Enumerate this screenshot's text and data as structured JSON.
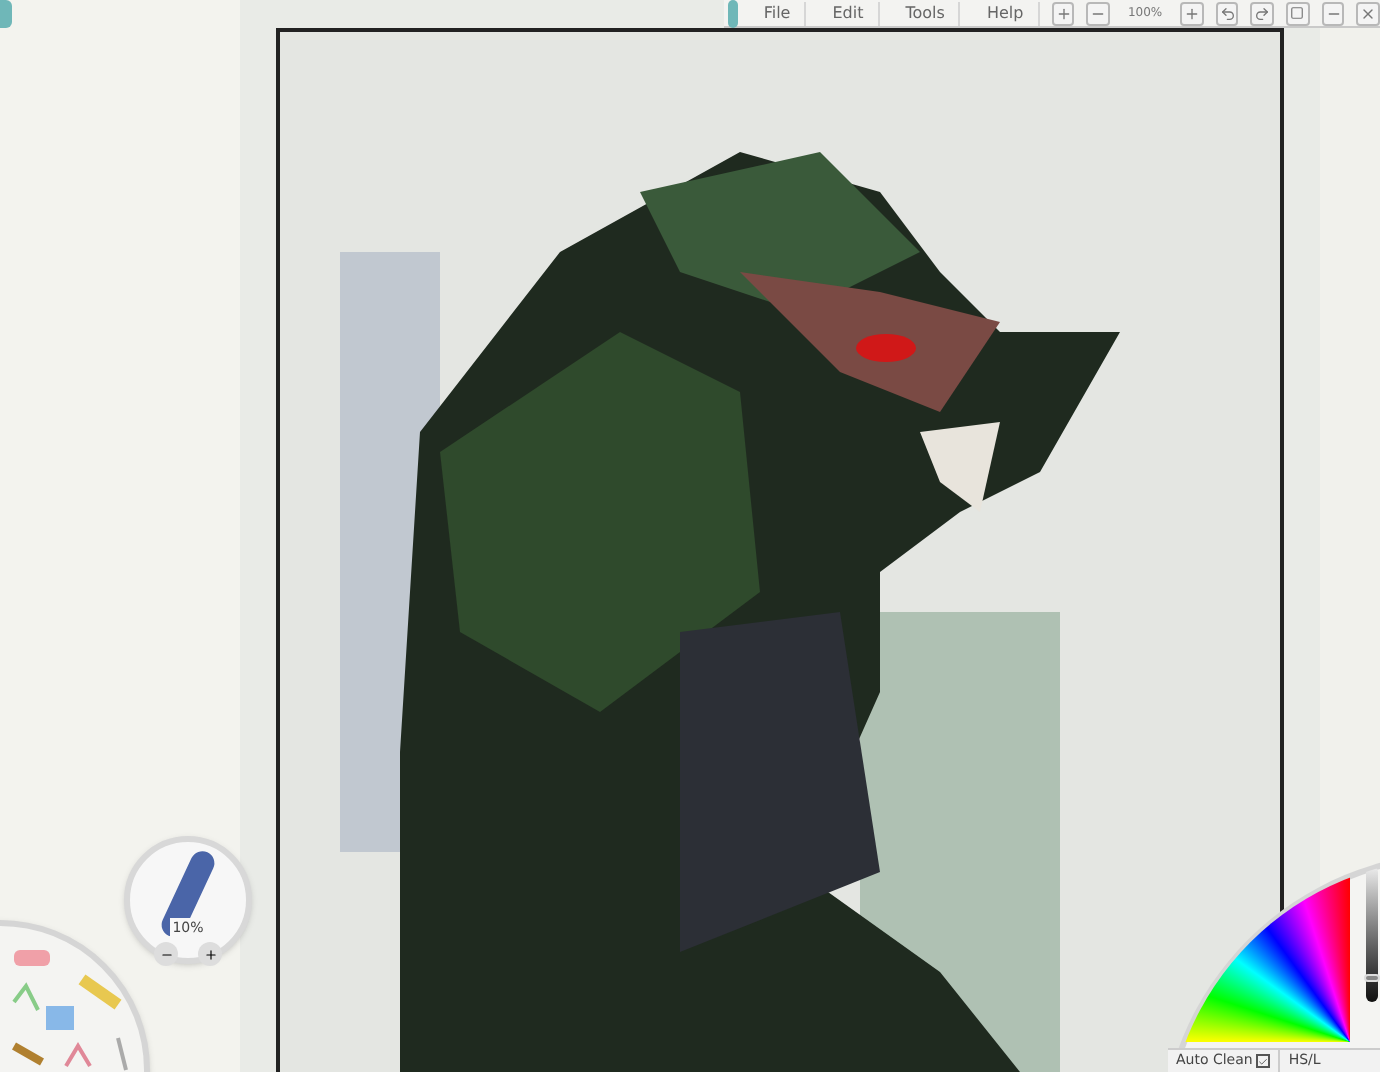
{
  "menu": [
    {
      "label": "File"
    },
    {
      "label": "Edit"
    },
    {
      "label": "Tools"
    },
    {
      "label": "Help"
    }
  ],
  "zoom": {
    "value": "100%"
  },
  "brush_size": {
    "value": "10%"
  },
  "color_picker": {
    "auto_clean": {
      "label": "Auto Clean",
      "checked": true
    },
    "mode": "HS/L",
    "lightness": {
      "level": 0.15
    }
  }
}
